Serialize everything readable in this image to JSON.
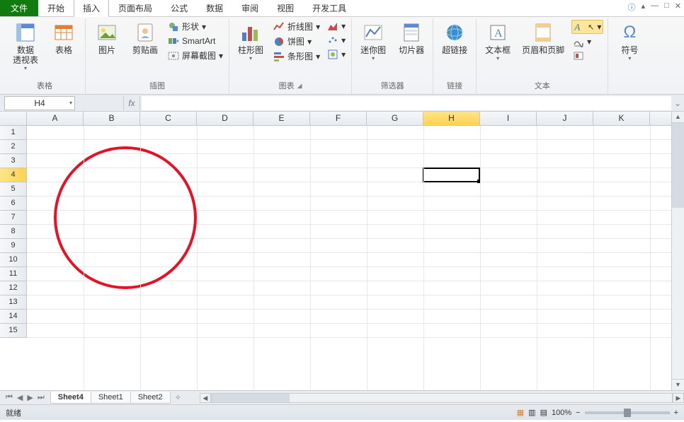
{
  "tabs": {
    "file": "文件",
    "home": "开始",
    "insert": "插入",
    "layout": "页面布局",
    "formula": "公式",
    "data": "数据",
    "review": "审阅",
    "view": "视图",
    "dev": "开发工具"
  },
  "window": {
    "help": "?",
    "min": "▾",
    "up": "▴",
    "rest": "□",
    "close": "✕"
  },
  "ribbon": {
    "grp_tables": "表格",
    "grp_illus": "插图",
    "grp_charts": "图表",
    "grp_filter": "筛选器",
    "grp_link": "链接",
    "grp_text": "文本",
    "grp_sym": "",
    "pivot": "数据\n透视表",
    "table": "表格",
    "image": "图片",
    "clip": "剪贴画",
    "shape": "形状",
    "smart": "SmartArt",
    "screen": "屏幕截图",
    "column": "柱形图",
    "line": "折线图",
    "pie": "饼图",
    "bar": "条形图",
    "spark": "迷你图",
    "slicer": "切片器",
    "link": "超链接",
    "textbox": "文本框",
    "hf": "页眉和页脚",
    "symbol": "符号"
  },
  "namebox": "H4",
  "fx": "fx",
  "cols": [
    "A",
    "B",
    "C",
    "D",
    "E",
    "F",
    "G",
    "H",
    "I",
    "J",
    "K"
  ],
  "rows": [
    1,
    2,
    3,
    4,
    5,
    6,
    7,
    8,
    9,
    10,
    11,
    12,
    13,
    14,
    15
  ],
  "active": {
    "col": "H",
    "row": 4
  },
  "sheets": {
    "s4": "Sheet4",
    "s1": "Sheet1",
    "s2": "Sheet2"
  },
  "status": {
    "ready": "就绪",
    "zoom": "100%"
  }
}
